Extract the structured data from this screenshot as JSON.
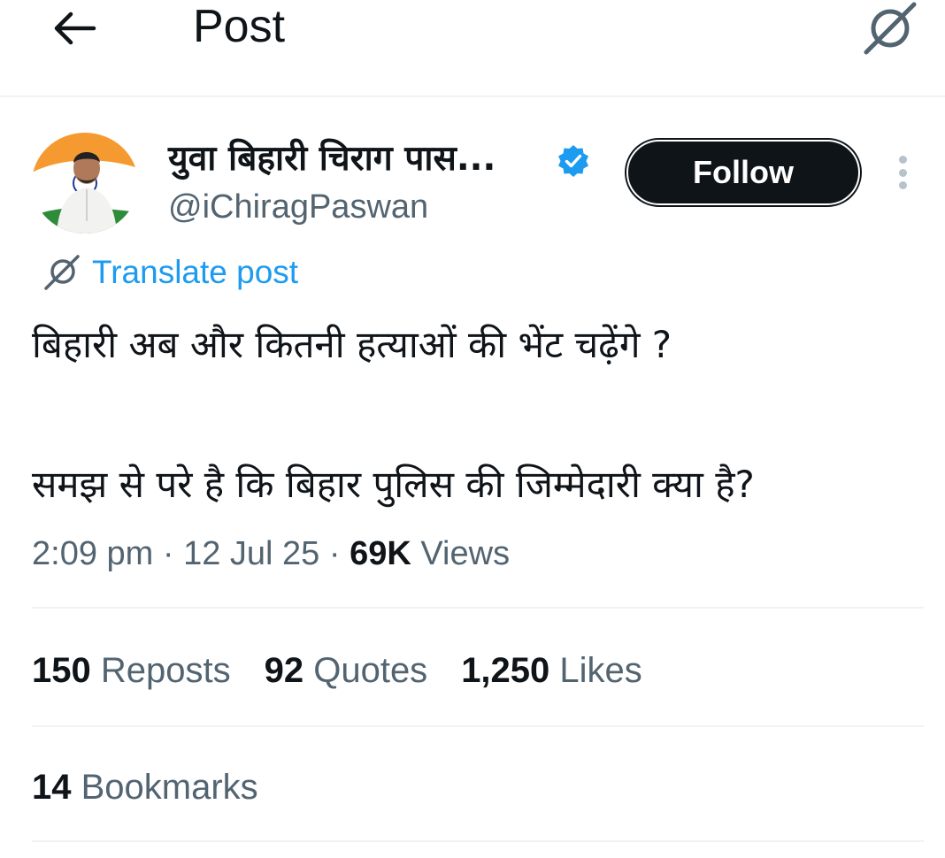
{
  "header": {
    "title": "Post",
    "back_icon": "arrow-left-icon",
    "grok_icon": "grok-icon"
  },
  "author": {
    "display_name": "युवा बिहारी चिराग पास...",
    "handle": "@iChiragPaswan",
    "verified": true,
    "verified_color": "#1d9bf0",
    "follow_label": "Follow"
  },
  "translate": {
    "label": "Translate post"
  },
  "post": {
    "line1": "बिहारी अब और कितनी हत्याओं की भेंट चढ़ेंगे ?",
    "line2": "समझ से परे है कि बिहार पुलिस की जिम्मेदारी क्या है?"
  },
  "meta": {
    "time": "2:09 pm",
    "date": "12 Jul 25",
    "views_count": "69K",
    "views_label": "Views",
    "separator": "·"
  },
  "stats": {
    "reposts_count": "150",
    "reposts_label": "Reposts",
    "quotes_count": "92",
    "quotes_label": "Quotes",
    "likes_count": "1,250",
    "likes_label": "Likes",
    "bookmarks_count": "14",
    "bookmarks_label": "Bookmarks"
  },
  "colors": {
    "text": "#0f1419",
    "secondary": "#536471",
    "link": "#1d9bf0",
    "divider": "#eff3f4"
  }
}
